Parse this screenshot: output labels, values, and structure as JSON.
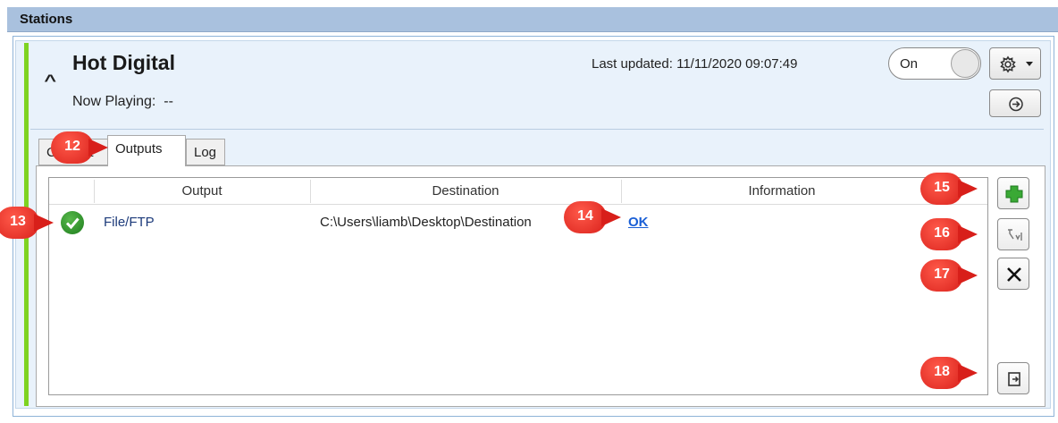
{
  "panel": {
    "title": "Stations"
  },
  "station": {
    "name": "Hot Digital",
    "now_playing_label": "Now Playing:",
    "now_playing_value": "--",
    "last_updated_label": "Last updated:",
    "last_updated_value": "11/11/2020 09:07:49",
    "toggle_label": "On",
    "toggle_state": "on",
    "accent_color": "#7ed321"
  },
  "tabs": [
    {
      "label": "Content",
      "selected": false
    },
    {
      "label": "Outputs",
      "selected": true
    },
    {
      "label": "Log",
      "selected": false
    }
  ],
  "outputs_table": {
    "columns": [
      "Output",
      "Destination",
      "Information"
    ],
    "rows": [
      {
        "status_icon": "check-circle-icon",
        "output": "File/FTP",
        "destination": "C:\\Users\\liamb\\Desktop\\Destination",
        "information": "OK"
      }
    ]
  },
  "side_buttons": [
    {
      "icon": "add-icon"
    },
    {
      "icon": "edit-output-icon"
    },
    {
      "icon": "delete-icon"
    },
    {
      "icon": "export-icon"
    }
  ],
  "callouts": [
    "12",
    "13",
    "14",
    "15",
    "16",
    "17",
    "18"
  ],
  "colors": {
    "callout": "#d81f1a",
    "title_bar": "#a9c1de",
    "link": "#1a5fd6"
  }
}
